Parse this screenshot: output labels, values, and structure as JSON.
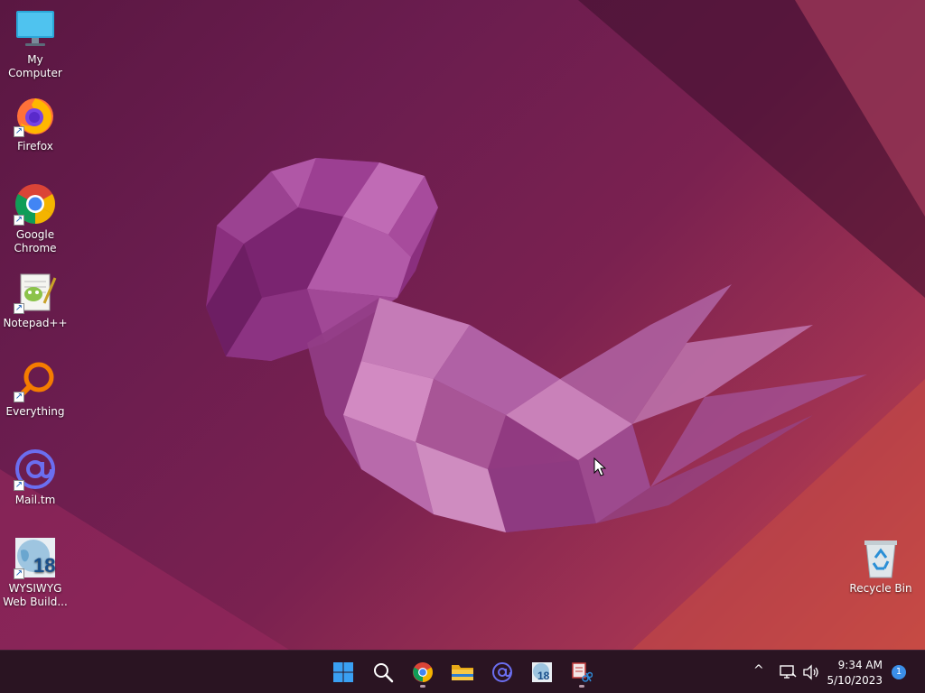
{
  "desktop": {
    "icons": [
      {
        "label": "My Computer",
        "icon": "monitor-icon",
        "shortcut": false
      },
      {
        "label": "Firefox",
        "icon": "firefox-icon",
        "shortcut": true
      },
      {
        "label": "Google Chrome",
        "icon": "chrome-icon",
        "shortcut": true
      },
      {
        "label": "Notepad++",
        "icon": "notepadpp-icon",
        "shortcut": true
      },
      {
        "label": "Everything",
        "icon": "everything-search-icon",
        "shortcut": true
      },
      {
        "label": "Mail.tm",
        "icon": "at-sign-icon",
        "shortcut": true
      },
      {
        "label": "WYSIWYG Web Build...",
        "icon": "wysiwyg-globe-icon",
        "shortcut": true
      },
      {
        "label": "Recycle Bin",
        "icon": "recycle-bin-icon",
        "shortcut": false
      }
    ],
    "shortcut_arrow": "↗"
  },
  "taskbar": {
    "apps": [
      {
        "name": "start",
        "icon": "windows-start-icon",
        "running": false
      },
      {
        "name": "search",
        "icon": "search-icon",
        "running": false
      },
      {
        "name": "chrome",
        "icon": "chrome-icon",
        "running": true
      },
      {
        "name": "file-explorer",
        "icon": "folder-icon",
        "running": false
      },
      {
        "name": "mail-tm",
        "icon": "at-sign-icon",
        "running": false
      },
      {
        "name": "wysiwyg",
        "icon": "wysiwyg-globe-icon",
        "running": false
      },
      {
        "name": "snipping-tool",
        "icon": "scissors-icon",
        "running": true
      }
    ],
    "wysiwyg_badge": "18",
    "tray": {
      "time": "9:34 AM",
      "date": "5/10/2023",
      "notification_count": "1",
      "chevron": "^"
    }
  },
  "colors": {
    "taskbar_bg": "#2a1422",
    "accent_blue": "#3b8fe8",
    "wallpaper_base": "#6b1d4f"
  }
}
